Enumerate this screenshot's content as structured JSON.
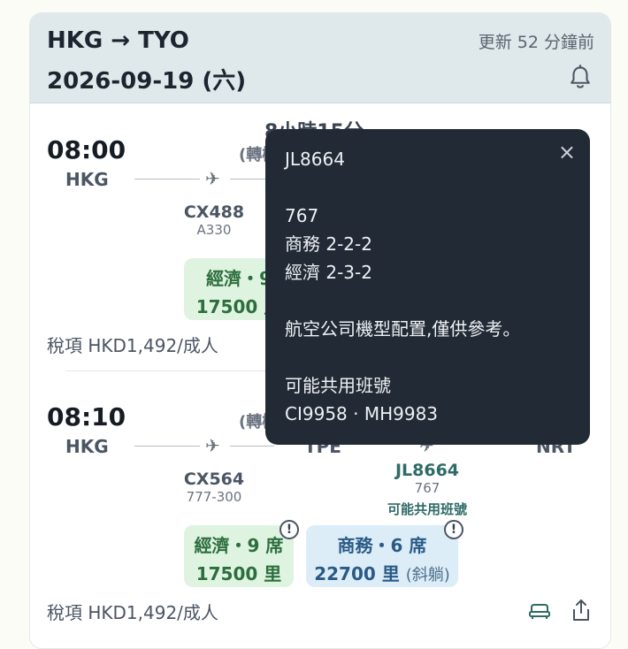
{
  "header": {
    "route": "HKG → TYO",
    "date": "2026-09-19 (六)",
    "updated": "更新 52 分鐘前",
    "bell_icon": "bell-icon"
  },
  "flights": [
    {
      "dep_time": "08:00",
      "dep_code": "HKG",
      "duration": "8小時15分",
      "transfer": "(轉機",
      "leg1_flight": "CX488",
      "leg1_aircraft": "A330",
      "econ_label": "經濟・9",
      "econ_miles": "17500 里",
      "tax": "稅項 HKD1,492/成人"
    },
    {
      "dep_time": "08:10",
      "dep_code": "HKG",
      "transfer": "(轉機",
      "via_code": "TPE",
      "arr_code": "NRT",
      "leg1_flight": "CX564",
      "leg1_aircraft": "777-300",
      "leg2_flight": "JL8664",
      "leg2_aircraft": "767",
      "leg2_note": "可能共用班號",
      "econ_label": "經濟・9 席",
      "econ_miles": "17500 里",
      "biz_label": "商務・6 席",
      "biz_miles": "22700 里",
      "biz_sub": "(斜躺)",
      "tax": "稅項 HKD1,492/成人"
    }
  ],
  "tooltip": {
    "flight": "JL8664",
    "aircraft": "767",
    "biz_config": "商務 2-2-2",
    "econ_config": "經濟 2-3-2",
    "note": "航空公司機型配置,僅供參考。",
    "codeshare_title": "可能共用班號",
    "codeshare_list": "CI9958 · MH9983",
    "close": "×"
  },
  "colors": {
    "header_bg": "#dfe9eb",
    "econ_bg": "#dff3e1",
    "biz_bg": "#dcedf8",
    "tooltip_bg": "#222a36"
  }
}
